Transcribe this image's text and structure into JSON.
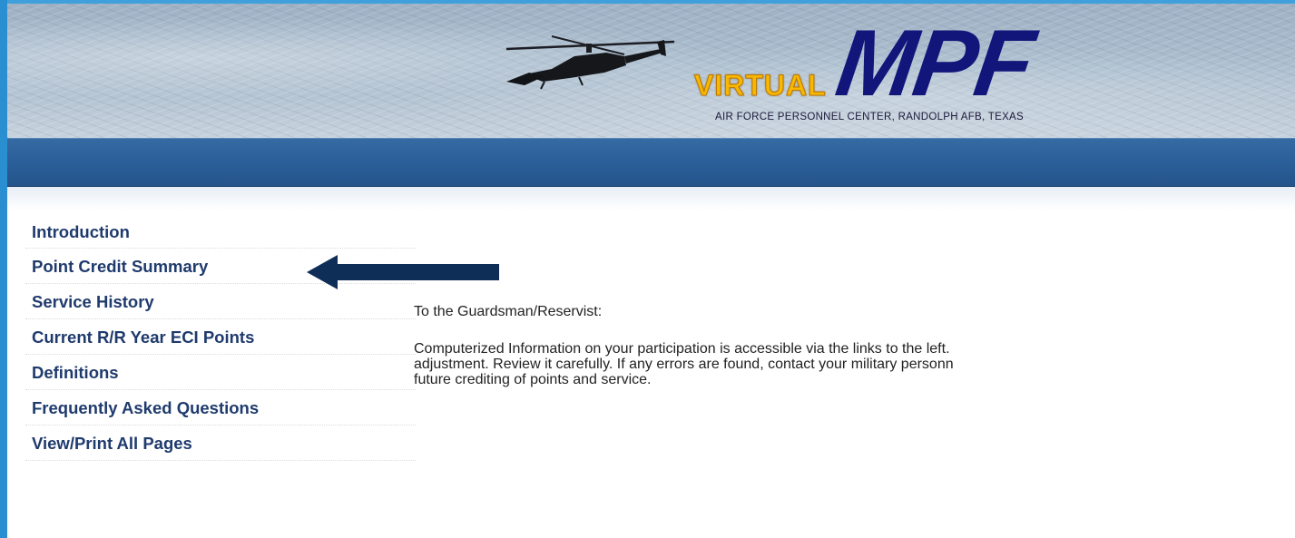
{
  "banner": {
    "logo_virtual": "VIRTUAL",
    "logo_mpf": "MPF",
    "subtitle": "AIR FORCE PERSONNEL CENTER, RANDOLPH AFB, TEXAS",
    "image_icon": "helicopter-icon"
  },
  "sidebar": {
    "items": [
      {
        "label": "Introduction"
      },
      {
        "label": "Point Credit Summary"
      },
      {
        "label": "Service History"
      },
      {
        "label": "Current R/R Year ECI Points"
      },
      {
        "label": "Definitions"
      },
      {
        "label": "Frequently Asked Questions"
      },
      {
        "label": "View/Print All Pages"
      }
    ]
  },
  "annotation": {
    "icon": "left-arrow-icon",
    "color": "#0f2e57"
  },
  "main": {
    "greeting": "To the Guardsman/Reservist:",
    "paragraph_lines": [
      "Computerized Information on your participation is accessible via the links to the left.",
      "adjustment. Review it carefully. If any errors are found, contact your military personn",
      "future crediting of points and service."
    ]
  },
  "colors": {
    "nav_link": "#1f3a6d",
    "blue_bar": "#2b5f99",
    "logo_mpf": "#12157a",
    "logo_virtual": "#f6b800"
  }
}
